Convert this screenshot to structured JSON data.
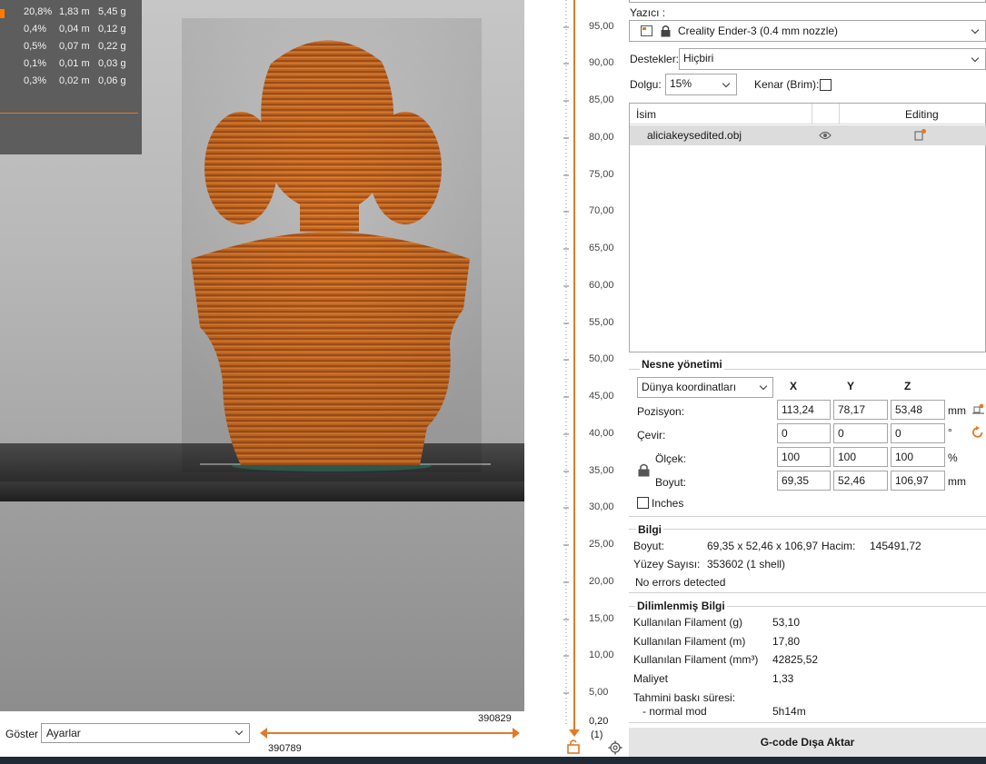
{
  "legend": {
    "rows": [
      {
        "pct": "20,8%",
        "len": "1,83 m",
        "wt": "5,45 g"
      },
      {
        "pct": "0,4%",
        "len": "0,04 m",
        "wt": "0,12 g"
      },
      {
        "pct": "0,5%",
        "len": "0,07 m",
        "wt": "0,22 g"
      },
      {
        "pct": "0,1%",
        "len": "0,01 m",
        "wt": "0,03 g"
      },
      {
        "pct": "0,3%",
        "len": "0,02 m",
        "wt": "0,06 g"
      }
    ],
    "accent_color": "#ff7b00"
  },
  "viewport": {
    "model_color": "#c5631c",
    "bed_color": "#333333"
  },
  "bottom": {
    "show_label": "Göster",
    "show_value": "Ayarlar",
    "h_slider_top": "390829",
    "h_slider_bottom": "390789"
  },
  "vruler": {
    "ticks": [
      "95,00",
      "90,00",
      "85,00",
      "80,00",
      "75,00",
      "70,00",
      "65,00",
      "60,00",
      "55,00",
      "50,00",
      "45,00",
      "40,00",
      "35,00",
      "30,00",
      "25,00",
      "20,00",
      "15,00",
      "10,00",
      "5,00"
    ],
    "bottom_value": "0,20",
    "bottom_count": "(1)"
  },
  "printer": {
    "label": "Yazıcı :",
    "value": "Creality Ender-3 (0.4 mm nozzle)"
  },
  "supports": {
    "label": "Destekler:",
    "value": "Hiçbiri"
  },
  "infill": {
    "label": "Dolgu:",
    "value": "15%",
    "brim_label": "Kenar (Brim):"
  },
  "object_list": {
    "col_name": "İsim",
    "col_editing": "Editing",
    "row_name": "aliciakeysedited.obj"
  },
  "object_manip": {
    "title": "Nesne yönetimi",
    "coord_mode": "Dünya koordinatları",
    "x": "X",
    "y": "Y",
    "z": "Z",
    "position_label": "Pozisyon:",
    "position": [
      "113,24",
      "78,17",
      "53,48"
    ],
    "position_unit": "mm",
    "rotate_label": "Çevir:",
    "rotate": [
      "0",
      "0",
      "0"
    ],
    "rotate_unit": "°",
    "scale_label": "Ölçek:",
    "scale": [
      "100",
      "100",
      "100"
    ],
    "scale_unit": "%",
    "size_label": "Boyut:",
    "size": [
      "69,35",
      "52,46",
      "106,97"
    ],
    "size_unit": "mm",
    "inches_label": "Inches"
  },
  "info": {
    "title": "Bilgi",
    "size_label": "Boyut:",
    "size_value": "69,35 x 52,46 x 106,97",
    "volume_label": "Hacim:",
    "volume_value": "145491,72",
    "facets_label": "Yüzey Sayısı:",
    "facets_value": "353602 (1 shell)",
    "errors": "No errors detected"
  },
  "sliced": {
    "title": "Dilimlenmiş Bilgi",
    "rows": [
      {
        "label": "Kullanılan Filament (g)",
        "value": "53,10"
      },
      {
        "label": "Kullanılan Filament (m)",
        "value": "17,80"
      },
      {
        "label": "Kullanılan Filament (mm³)",
        "value": "42825,52"
      },
      {
        "label": "Maliyet",
        "value": "1,33"
      }
    ],
    "time_label": "Tahmini baskı süresi:",
    "mode_label": "- normal mod",
    "mode_value": "5h14m"
  },
  "export_button": "G-code Dışa Aktar"
}
